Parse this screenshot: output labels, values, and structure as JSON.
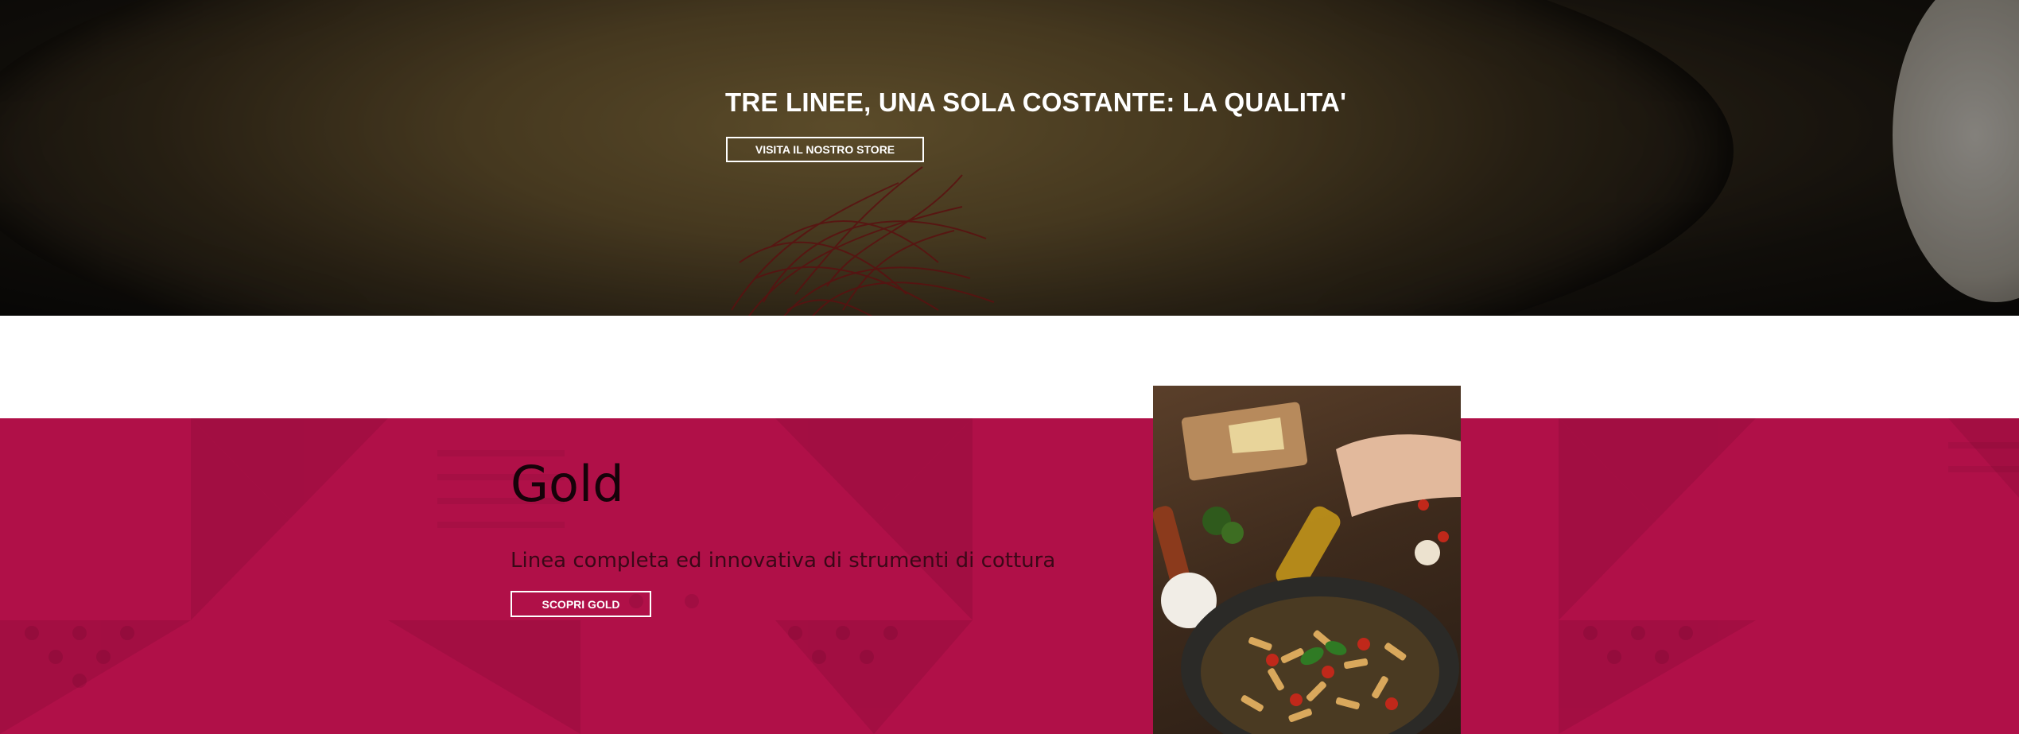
{
  "hero": {
    "title": "TRE LINEE, UNA SOLA COSTANTE: LA QUALITA'",
    "button_label": "VISITA IL NOSTRO STORE",
    "image_label": "risotto-background"
  },
  "gold": {
    "title": "Gold",
    "description": "Linea completa ed innovativa di strumenti di cottura",
    "button_label": "SCOPRI GOLD",
    "image_label": "pasta-pan-photo"
  },
  "colors": {
    "accent": "#b01048",
    "dark_text": "#160209",
    "button_border": "#ffffff"
  }
}
